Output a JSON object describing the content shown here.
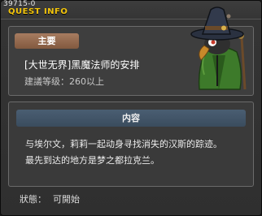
{
  "window": {
    "id": "39715-0",
    "title": "QUEST INFO"
  },
  "summary": {
    "tag": "主要",
    "quest_name": "[大世无界]黑魔法师的安排",
    "level_requirement": "建議等级：260以上"
  },
  "portrait": {
    "icon": "wizard-crow-npc",
    "hat_color": "#2a3140",
    "coat_color": "#3d7a2a",
    "beak_color": "#c8892a"
  },
  "content": {
    "header": "内容",
    "lines": [
      "与埃尔文，莉莉一起动身寻找消失的汉斯的踪迹。",
      "最先到达的地方是梦之都拉克兰。"
    ]
  },
  "status": {
    "label": "狀態：",
    "value": "可開始"
  },
  "colors": {
    "title_accent": "#f3c50c",
    "tag_bg": "#a77c60",
    "header_bg": "#4a5e72"
  }
}
